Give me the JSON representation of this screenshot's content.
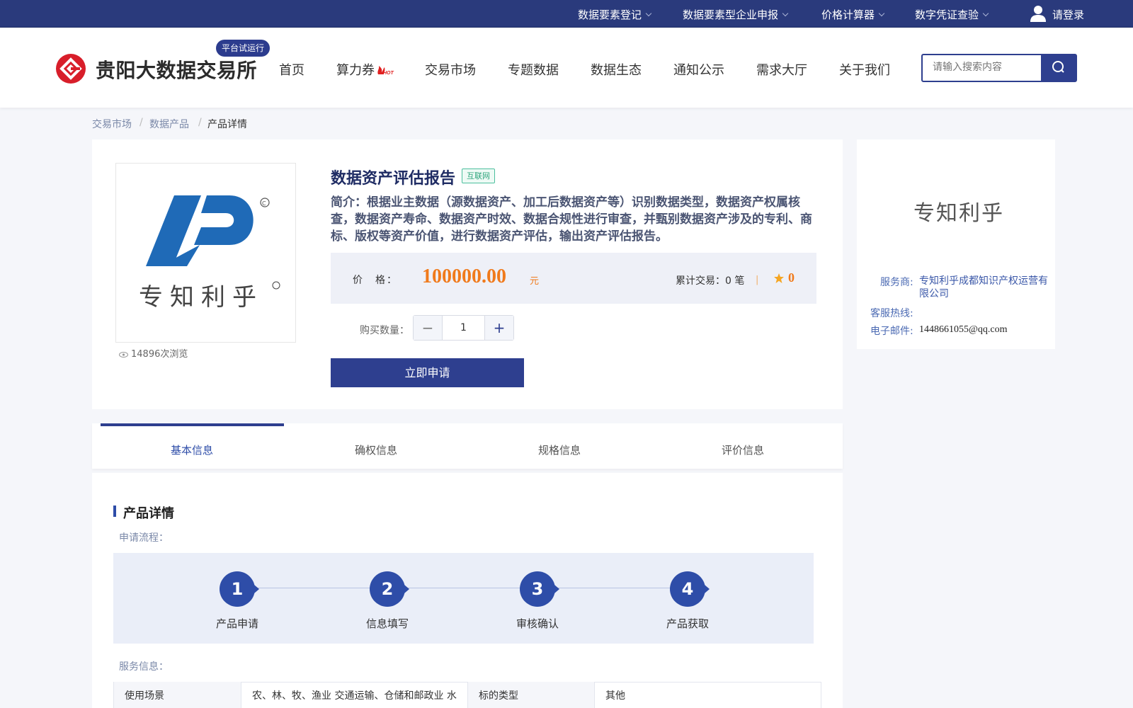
{
  "topbar": {
    "links": [
      "数据要素登记",
      "数据要素型企业申报",
      "价格计算器",
      "数字凭证查验"
    ],
    "login": "请登录"
  },
  "header": {
    "site_name": "贵阳大数据交易所",
    "beta_badge": "平台试运行",
    "nav": [
      "首页",
      "算力券",
      "交易市场",
      "专题数据",
      "数据生态",
      "通知公示",
      "需求大厅",
      "关于我们"
    ],
    "hot_badge": "HOT",
    "search_placeholder": "请输入搜索内容"
  },
  "breadcrumb": [
    "交易市场",
    "数据产品",
    "产品详情"
  ],
  "breadcrumb_sep": "/",
  "product": {
    "title": "数据资产评估报告",
    "tag": "互联网",
    "description": "简介：根据业主数据（源数据资产、加工后数据资产等）识别数据类型，数据资产权属核查，数据资产寿命、数据资产时效、数据合规性进行审查，并甄别数据资产涉及的专利、商标、版权等资产价值，进行数据资产评估，输出资产评估报告。",
    "price_label": "价　格：",
    "price": "100000.00",
    "price_unit": "元",
    "trade_count_label": "累计交易：",
    "trade_count": "0 笔",
    "divider": "|",
    "rating": "0",
    "qty_label": "购买数量：",
    "quantity": "1",
    "apply_button": "立即申请",
    "views": "14896次浏览",
    "image_brand_text": "专知利乎"
  },
  "seller": {
    "logo_text": "专知利乎",
    "provider_label": "服务商:",
    "provider_name": "专知利乎成都知识产权运营有限公司",
    "hotline_label": "客服热线:",
    "hotline": "",
    "email_label": "电子邮件:",
    "email": "1448661055@qq.com"
  },
  "tabs": [
    "基本信息",
    "确权信息",
    "规格信息",
    "评价信息"
  ],
  "detail": {
    "section_title": "产品详情",
    "process_label": "申请流程：",
    "steps": [
      {
        "num": "1",
        "label": "产品申请"
      },
      {
        "num": "2",
        "label": "信息填写"
      },
      {
        "num": "3",
        "label": "审核确认"
      },
      {
        "num": "4",
        "label": "产品获取"
      }
    ],
    "service_label": "服务信息：",
    "service_rows": [
      {
        "k1": "使用场景",
        "v1": "农、林、牧、渔业 交通运输、仓储和邮政业 水",
        "k2": "标的类型",
        "v2": "其他"
      }
    ]
  },
  "colors": {
    "primary": "#2e3f8f",
    "price": "#f07a1b",
    "topbar": "#2a3a7c"
  }
}
